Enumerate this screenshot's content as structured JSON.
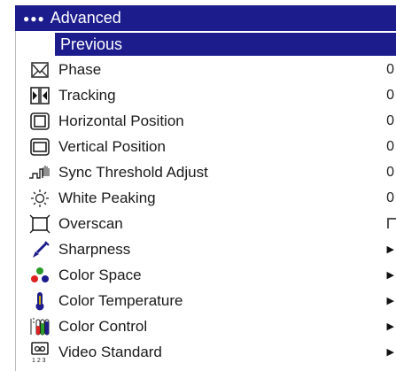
{
  "menu": {
    "title": "Advanced",
    "title_icon": "three-dots-icon",
    "previous_label": "Previous",
    "items": [
      {
        "label": "Phase",
        "icon": "phase-icon",
        "value": "0",
        "kind": "value"
      },
      {
        "label": "Tracking",
        "icon": "tracking-icon",
        "value": "0",
        "kind": "value"
      },
      {
        "label": "Horizontal Position",
        "icon": "horizontal-position-icon",
        "value": "0",
        "kind": "value"
      },
      {
        "label": "Vertical Position",
        "icon": "vertical-position-icon",
        "value": "0",
        "kind": "value"
      },
      {
        "label": "Sync Threshold Adjust",
        "icon": "sync-threshold-icon",
        "value": "0",
        "kind": "value"
      },
      {
        "label": "White Peaking",
        "icon": "white-peaking-icon",
        "value": "0",
        "kind": "value"
      },
      {
        "label": "Overscan",
        "icon": "overscan-icon",
        "value": "",
        "kind": "checkbox"
      },
      {
        "label": "Sharpness",
        "icon": "sharpness-icon",
        "value": "▶",
        "kind": "submenu"
      },
      {
        "label": "Color Space",
        "icon": "color-space-icon",
        "value": "▶",
        "kind": "submenu"
      },
      {
        "label": "Color Temperature",
        "icon": "color-temperature-icon",
        "value": "▶",
        "kind": "submenu"
      },
      {
        "label": "Color Control",
        "icon": "color-control-icon",
        "value": "▶",
        "kind": "submenu"
      },
      {
        "label": "Video Standard",
        "icon": "video-standard-icon",
        "value": "▶",
        "kind": "submenu"
      }
    ]
  },
  "colors": {
    "highlight": "#1c1c8c",
    "highlight_text": "#ffffff"
  }
}
